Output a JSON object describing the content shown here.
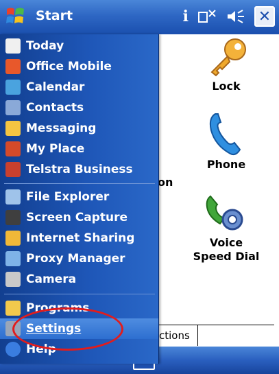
{
  "titlebar": {
    "title": "Start",
    "status_icon": "i"
  },
  "menu": {
    "items": [
      {
        "label": "Today",
        "icon": "home-icon",
        "color": "#f0f0f0"
      },
      {
        "label": "Office Mobile",
        "icon": "office-icon",
        "color": "#e8582b"
      },
      {
        "label": "Calendar",
        "icon": "calendar-icon",
        "color": "#4aa3df"
      },
      {
        "label": "Contacts",
        "icon": "contacts-icon",
        "color": "#8aa9d8"
      },
      {
        "label": "Messaging",
        "icon": "messaging-icon",
        "color": "#f4c542"
      },
      {
        "label": "My Place",
        "icon": "myplace-icon",
        "color": "#d54a2a"
      },
      {
        "label": "Telstra Business",
        "icon": "telstra-icon",
        "color": "#c9402e"
      },
      {
        "label": "File Explorer",
        "icon": "file-explorer-icon",
        "color": "#9fc3ea"
      },
      {
        "label": "Screen Capture",
        "icon": "screen-capture-icon",
        "color": "#3f3f3f"
      },
      {
        "label": "Internet Sharing",
        "icon": "internet-sharing-icon",
        "color": "#f0b838"
      },
      {
        "label": "Proxy Manager",
        "icon": "proxy-manager-icon",
        "color": "#7fb3e8"
      },
      {
        "label": "Camera",
        "icon": "camera-icon",
        "color": "#c9c9c9"
      },
      {
        "label": "Programs",
        "icon": "programs-icon",
        "color": "#f2c94c"
      },
      {
        "label": "Settings",
        "icon": "settings-icon",
        "color": "#9aa6b8"
      },
      {
        "label": "Help",
        "icon": "help-icon",
        "color": "#3a7de0"
      }
    ]
  },
  "grid": {
    "programs": [
      {
        "label": "Lock"
      },
      {
        "label": "Phone"
      },
      {
        "label": "Voice Speed Dial"
      }
    ],
    "partial_label": "on"
  },
  "tabs": {
    "partial_tab": "ctions"
  }
}
